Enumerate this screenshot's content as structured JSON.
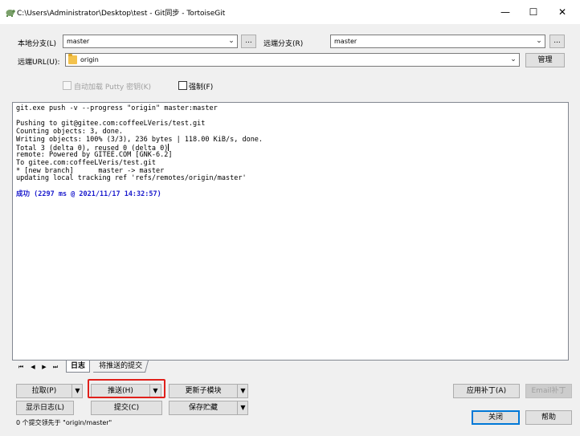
{
  "window": {
    "title": "C:\\Users\\Administrator\\Desktop\\test - Git同步 - TortoiseGit",
    "app_icon": "tortoisegit-icon",
    "minimize": "—",
    "maximize": "☐",
    "close": "✕"
  },
  "branches": {
    "local_label": "本地分支(L)",
    "local_value": "master",
    "remote_label": "远端分支(R)",
    "remote_value": "master",
    "more": "..."
  },
  "remote_url": {
    "label": "远端URL(U):",
    "value": "origin",
    "manage": "管理"
  },
  "options": {
    "autoload_putty": "自动加载 Putty 密钥(K)",
    "force": "强制(F)"
  },
  "log": {
    "lines": [
      "git.exe push -v --progress \"origin\" master:master",
      "",
      "Pushing to git@gitee.com:coffeeLVeris/test.git",
      "Counting objects: 3, done.",
      "Writing objects: 100% (3/3), 236 bytes | 118.00 KiB/s, done.",
      "Total 3 (delta 0), reused 0 (delta 0)",
      "remote: Powered by GITEE.COM [GNK-6.2]",
      "To gitee.com:coffeeLVeris/test.git",
      "* [new branch]      master -> master",
      "updating local tracking ref 'refs/remotes/origin/master'",
      "",
      ""
    ],
    "success": "成功 (2297 ms @ 2021/11/17 14:32:57)"
  },
  "tabs": {
    "first": "⏮",
    "prev": "◀",
    "next": "▶",
    "last": "⏭",
    "log": "日志",
    "unpushed": "将推送的提交"
  },
  "buttons": {
    "pull": "拉取(P)",
    "push": "推送(H)",
    "update_submodules": "更新子模块",
    "show_log": "显示日志(L)",
    "commit": "提交(C)",
    "stash": "保存贮藏",
    "apply_patch": "应用补丁(A)",
    "email_patch": "Email补丁",
    "close": "关闭",
    "help": "帮助",
    "dropdown": "▼"
  },
  "status": "0 个提交领先于 \"origin/master\"",
  "colors": {
    "highlight": "#e0201b",
    "success_text": "#1a1acd",
    "default_button_border": "#0078d7"
  }
}
